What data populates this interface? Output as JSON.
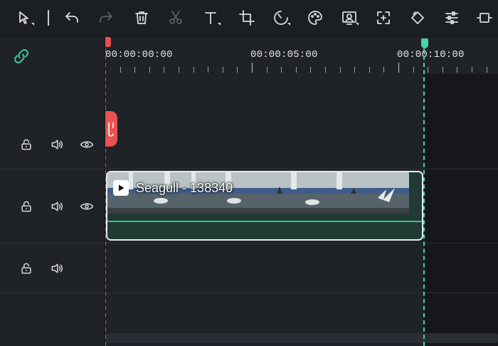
{
  "toolbar": {
    "tools": [
      {
        "name": "select-tool",
        "icon": "cursor-arrow-icon",
        "enabled": true
      },
      {
        "name": "undo-button",
        "icon": "undo-icon",
        "enabled": true
      },
      {
        "name": "redo-button",
        "icon": "redo-icon",
        "enabled": false
      },
      {
        "name": "delete-button",
        "icon": "trash-icon",
        "enabled": true
      },
      {
        "name": "cut-button",
        "icon": "scissors-icon",
        "enabled": false
      },
      {
        "name": "text-button",
        "icon": "text-icon",
        "enabled": true
      },
      {
        "name": "crop-button",
        "icon": "crop-icon",
        "enabled": true
      },
      {
        "name": "speed-button",
        "icon": "speed-icon",
        "enabled": true
      },
      {
        "name": "color-button",
        "icon": "palette-icon",
        "enabled": true
      },
      {
        "name": "green-screen-button",
        "icon": "portrait-icon",
        "enabled": true
      },
      {
        "name": "zoom-fit-button",
        "icon": "expand-icon",
        "enabled": true
      },
      {
        "name": "keyframe-button",
        "icon": "keyframe-icon",
        "enabled": true
      },
      {
        "name": "adjust-button",
        "icon": "sliders-icon",
        "enabled": true
      },
      {
        "name": "more-button",
        "icon": "film-icon",
        "enabled": true
      }
    ]
  },
  "ruler": {
    "timecodes": [
      "00:00:00:00",
      "00:00:05:00",
      "00:00:10:00"
    ]
  },
  "tracks": [
    {
      "type": "video",
      "controls": [
        "lock-icon",
        "speaker-icon",
        "eye-icon"
      ]
    },
    {
      "type": "video",
      "controls": [
        "lock-icon",
        "speaker-icon",
        "eye-icon"
      ]
    },
    {
      "type": "audio",
      "controls": [
        "lock-icon",
        "speaker-icon"
      ]
    }
  ],
  "clip": {
    "name": "Seagull - 138340",
    "badge_icon": "play-icon"
  },
  "colors": {
    "playhead": "#e9524e",
    "end_marker": "#49d3ad",
    "audio_strip": "#1f3b33",
    "background": "#1f2227"
  }
}
